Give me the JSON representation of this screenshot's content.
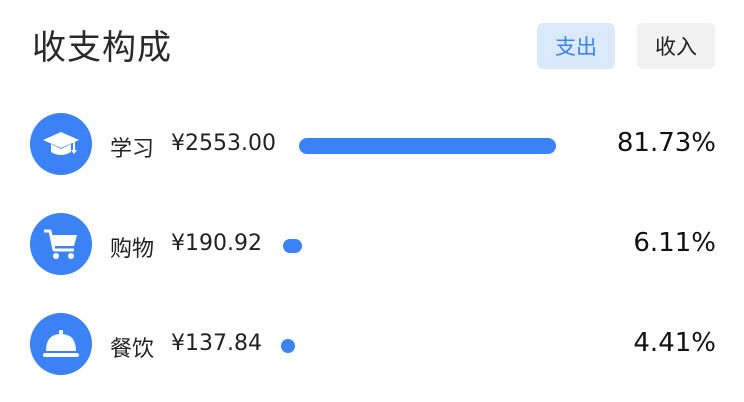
{
  "header": {
    "title": "收支构成",
    "tabs": [
      {
        "label": "支出",
        "active": true
      },
      {
        "label": "收入",
        "active": false
      }
    ]
  },
  "items": [
    {
      "icon": "graduation-cap-icon",
      "category": "学习",
      "amount": "¥2553.00",
      "percent": "81.73%",
      "ratio": 0.8173
    },
    {
      "icon": "shopping-cart-icon",
      "category": "购物",
      "amount": "¥190.92",
      "percent": "6.11%",
      "ratio": 0.0611
    },
    {
      "icon": "food-cloche-icon",
      "category": "餐饮",
      "amount": "¥137.84",
      "percent": "4.41%",
      "ratio": 0.0441
    }
  ],
  "colors": {
    "accent": "#3a82f6",
    "active_tab_bg": "#dbe9fc",
    "inactive_tab_bg": "#f2f2f2"
  }
}
